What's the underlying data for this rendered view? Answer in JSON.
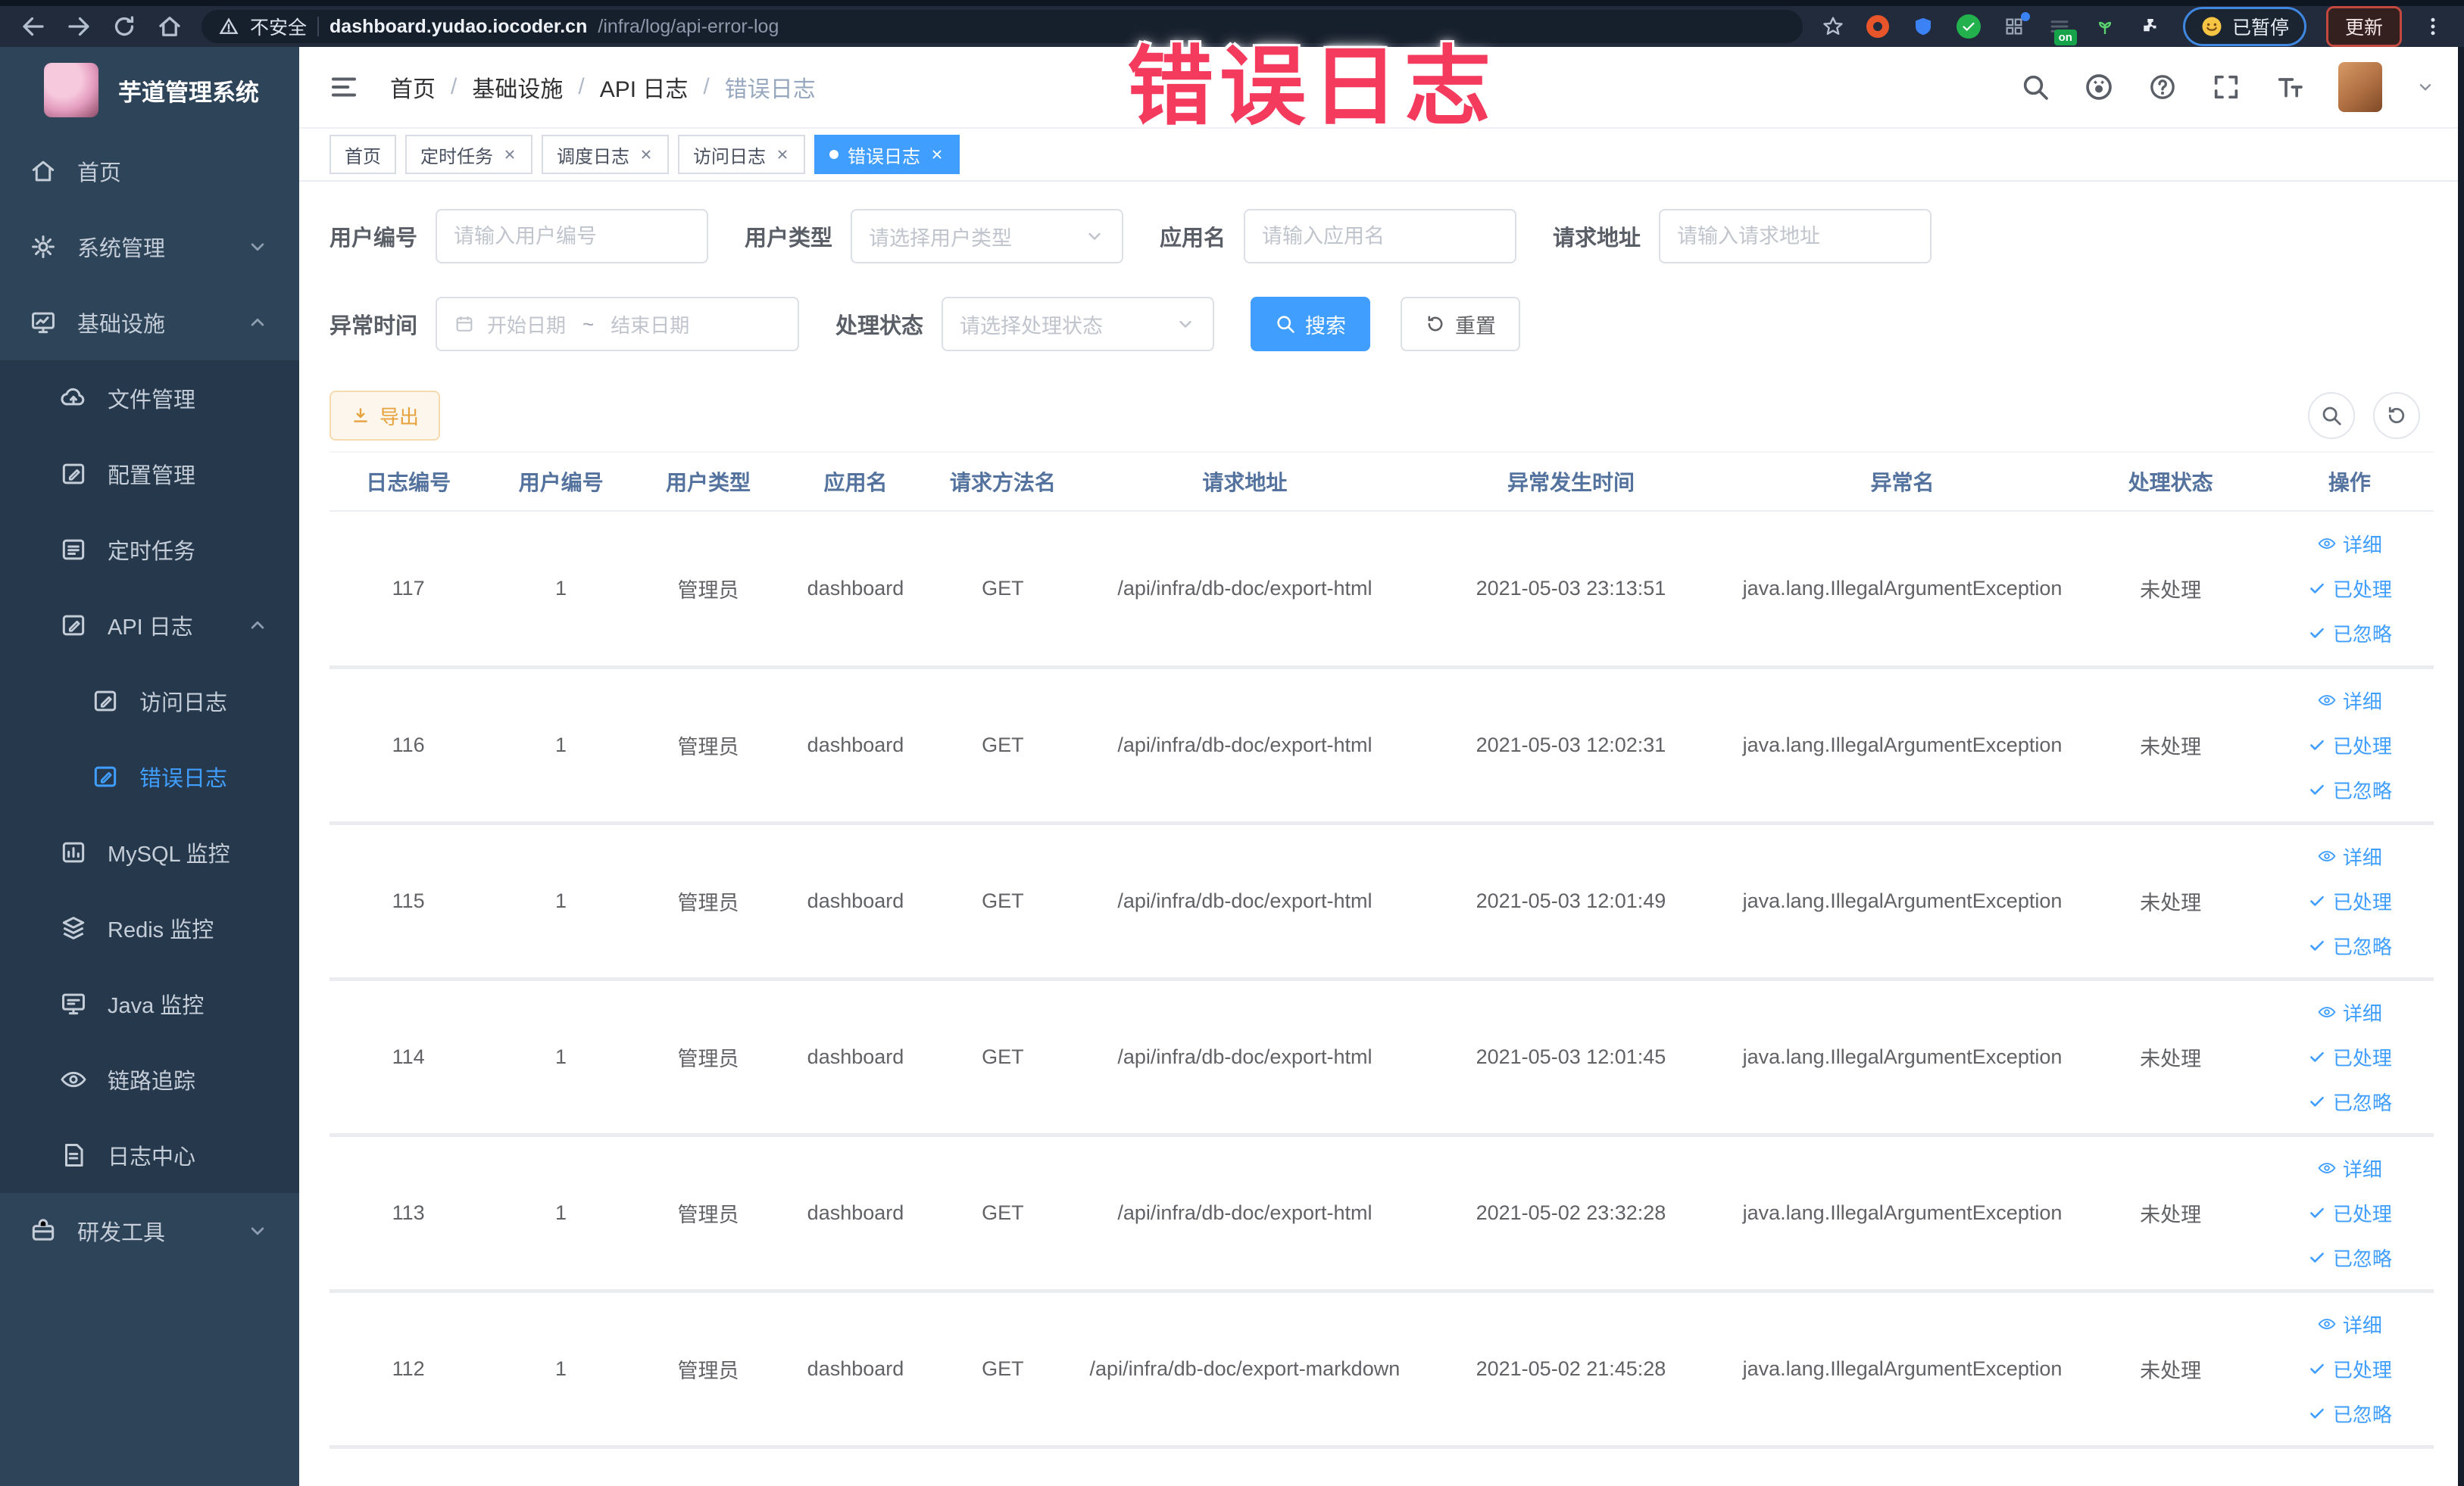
{
  "browser": {
    "security_label": "不安全",
    "url_domain": "dashboard.yudao.iocoder.cn",
    "url_path": "/infra/log/api-error-log",
    "ext_on_badge": "on",
    "paused_badge": "已暂停",
    "update_button": "更新"
  },
  "overlay": {
    "text": "错误日志"
  },
  "sidebar": {
    "logo_title": "芋道管理系统",
    "home": "首页",
    "system_mgmt": "系统管理",
    "infrastructure": "基础设施",
    "file_mgmt": "文件管理",
    "config_mgmt": "配置管理",
    "scheduled_tasks": "定时任务",
    "api_log": "API 日志",
    "access_log": "访问日志",
    "error_log": "错误日志",
    "mysql_monitor": "MySQL 监控",
    "redis_monitor": "Redis 监控",
    "java_monitor": "Java 监控",
    "trace": "链路追踪",
    "log_center": "日志中心",
    "dev_tools": "研发工具"
  },
  "header": {
    "breadcrumbs": [
      "首页",
      "基础设施",
      "API 日志",
      "错误日志"
    ]
  },
  "tabs": {
    "items": [
      "首页",
      "定时任务",
      "调度日志",
      "访问日志",
      "错误日志"
    ]
  },
  "filters": {
    "user_id_label": "用户编号",
    "user_id_placeholder": "请输入用户编号",
    "user_type_label": "用户类型",
    "user_type_placeholder": "请选择用户类型",
    "app_name_label": "应用名",
    "app_name_placeholder": "请输入应用名",
    "request_url_label": "请求地址",
    "request_url_placeholder": "请输入请求地址",
    "exception_time_label": "异常时间",
    "start_date_placeholder": "开始日期",
    "range_separator": "~",
    "end_date_placeholder": "结束日期",
    "process_status_label": "处理状态",
    "process_status_placeholder": "请选择处理状态",
    "search_button": "搜索",
    "reset_button": "重置"
  },
  "toolbar": {
    "export_button": "导出"
  },
  "table": {
    "columns": [
      "日志编号",
      "用户编号",
      "用户类型",
      "应用名",
      "请求方法名",
      "请求地址",
      "异常发生时间",
      "异常名",
      "处理状态",
      "操作"
    ],
    "actions": {
      "detail": "详细",
      "processed": "已处理",
      "ignored": "已忽略"
    },
    "rows": [
      {
        "id": "117",
        "user_id": "1",
        "user_type": "管理员",
        "app": "dashboard",
        "method": "GET",
        "url": "/api/infra/db-doc/export-html",
        "time": "2021-05-03 23:13:51",
        "exception": "java.lang.IllegalArgumentException",
        "status": "未处理"
      },
      {
        "id": "116",
        "user_id": "1",
        "user_type": "管理员",
        "app": "dashboard",
        "method": "GET",
        "url": "/api/infra/db-doc/export-html",
        "time": "2021-05-03 12:02:31",
        "exception": "java.lang.IllegalArgumentException",
        "status": "未处理"
      },
      {
        "id": "115",
        "user_id": "1",
        "user_type": "管理员",
        "app": "dashboard",
        "method": "GET",
        "url": "/api/infra/db-doc/export-html",
        "time": "2021-05-03 12:01:49",
        "exception": "java.lang.IllegalArgumentException",
        "status": "未处理"
      },
      {
        "id": "114",
        "user_id": "1",
        "user_type": "管理员",
        "app": "dashboard",
        "method": "GET",
        "url": "/api/infra/db-doc/export-html",
        "time": "2021-05-03 12:01:45",
        "exception": "java.lang.IllegalArgumentException",
        "status": "未处理"
      },
      {
        "id": "113",
        "user_id": "1",
        "user_type": "管理员",
        "app": "dashboard",
        "method": "GET",
        "url": "/api/infra/db-doc/export-html",
        "time": "2021-05-02 23:32:28",
        "exception": "java.lang.IllegalArgumentException",
        "status": "未处理"
      },
      {
        "id": "112",
        "user_id": "1",
        "user_type": "管理员",
        "app": "dashboard",
        "method": "GET",
        "url": "/api/infra/db-doc/export-markdown",
        "time": "2021-05-02 21:45:28",
        "exception": "java.lang.IllegalArgumentException",
        "status": "未处理"
      }
    ]
  },
  "colors": {
    "primary": "#409EFF",
    "warning_text": "#E6A23C",
    "annotation": "#F43B5E",
    "sidebar_bg": "#2E4459",
    "chrome_bg": "#212B3B"
  }
}
